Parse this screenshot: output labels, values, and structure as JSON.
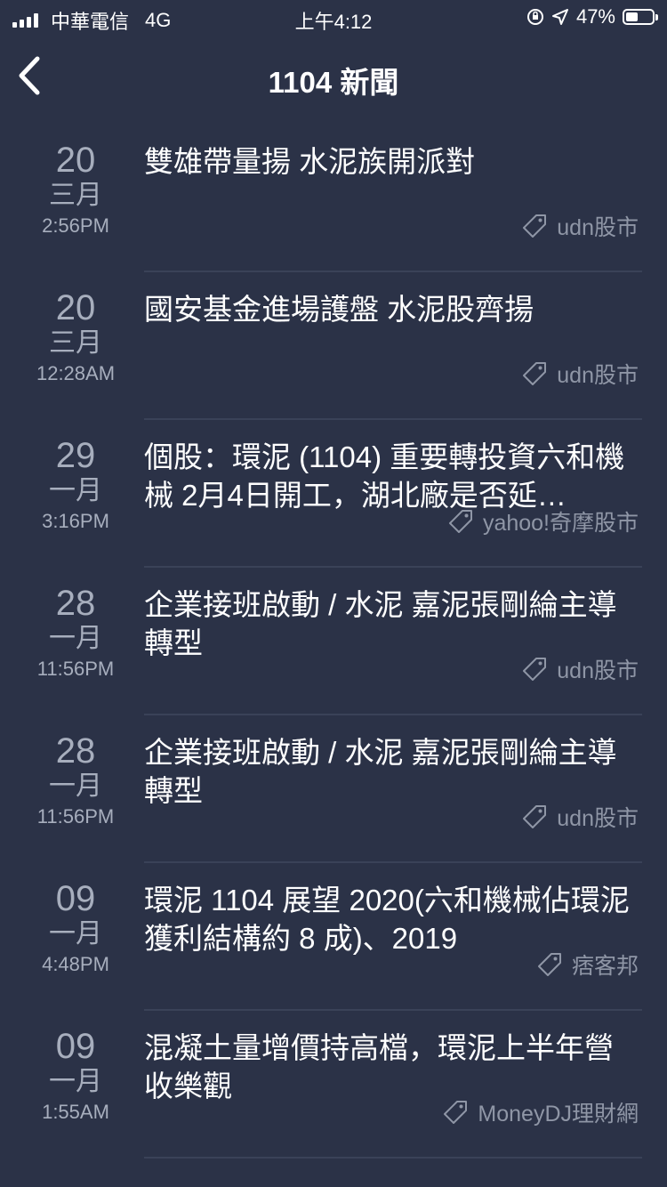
{
  "status_bar": {
    "carrier": "中華電信",
    "network": "4G",
    "time": "上午4:12",
    "battery": "47%",
    "battery_level": 0.47
  },
  "nav": {
    "title": "1104 新聞",
    "back_icon": "chevron-left-icon"
  },
  "news": [
    {
      "day": "20",
      "month": "三月",
      "time": "2:56PM",
      "title": "雙雄帶量揚 水泥族開派對",
      "source": "udn股市"
    },
    {
      "day": "20",
      "month": "三月",
      "time": "12:28AM",
      "title": "國安基金進場護盤 水泥股齊揚",
      "source": "udn股市"
    },
    {
      "day": "29",
      "month": "一月",
      "time": "3:16PM",
      "title": "個股：環泥 (1104) 重要轉投資六和機械 2月4日開工，湖北廠是否延…",
      "source": "yahoo!奇摩股市"
    },
    {
      "day": "28",
      "month": "一月",
      "time": "11:56PM",
      "title": "企業接班啟動 / 水泥 嘉泥張剛綸主導轉型",
      "source": "udn股市"
    },
    {
      "day": "28",
      "month": "一月",
      "time": "11:56PM",
      "title": "企業接班啟動 / 水泥 嘉泥張剛綸主導轉型",
      "source": "udn股市"
    },
    {
      "day": "09",
      "month": "一月",
      "time": "4:48PM",
      "title": "環泥 1104 展望 2020(六和機械佔環泥獲利結構約 8 成)、2019",
      "source": "痞客邦"
    },
    {
      "day": "09",
      "month": "一月",
      "time": "1:55AM",
      "title": "混凝土量增價持高檔，環泥上半年營收樂觀",
      "source": "MoneyDJ理財網"
    }
  ]
}
